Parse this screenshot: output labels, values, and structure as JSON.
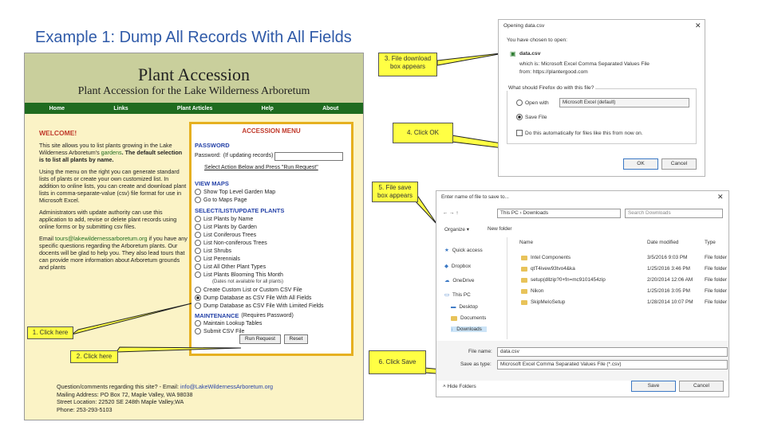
{
  "slide": {
    "title": "Example 1: Dump All Records With All Fields"
  },
  "webpage": {
    "banner_title": "Plant Accession",
    "banner_subtitle": "Plant Accession for the Lake Wilderness Arboretum",
    "nav": [
      "Home",
      "Links",
      "Plant Articles",
      "Help",
      "About"
    ],
    "welcome_heading": "WELCOME!",
    "welcome_p1a": "This site allows you to list plants growing in the Lake Wilderness Arboretum's ",
    "welcome_p1_link": "gardens",
    "welcome_p1b": ". The default selection is to list all plants by name.",
    "welcome_p2": "Using the menu on the right you can generate standard lists of plants or create your own customized list. In addition to online lists, you can create and download plant lists in comma-separate-value (csv) file format for use in Microsoft Excel.",
    "welcome_p3": "Administrators with update authority can use this application to add, revise or delete plant records using online forms or by submitting csv files.",
    "welcome_p4a": "Email ",
    "welcome_p4_link": "tours@lakewildernessarboretum.org",
    "welcome_p4b": " if you have any specific questions regarding the Arboretum plants. Our docents will be glad to help you. They also lead tours that can provide more information about Arboretum grounds and plants",
    "menu": {
      "title": "ACCESSION MENU",
      "password_heading": "PASSWORD",
      "password_note": "(If updating records)",
      "password_label": "Password:",
      "select_action_link": "Select Action Below and Press \"Run Request\"",
      "view_maps_heading": "VIEW MAPS",
      "maps_options": [
        "Show Top Level Garden Map",
        "Go to Maps Page"
      ],
      "select_heading": "SELECT/LIST/UPDATE PLANTS",
      "list_options": [
        "List Plants by Name",
        "List Plants by Garden",
        "List Coniferous Trees",
        "List Non-coniferous Trees",
        "List Shrubs",
        "List Perennials",
        "List All Other Plant Types",
        "List Plants Blooming This Month"
      ],
      "notes_all_plants": "(Dates not available for all plants)",
      "csv_options": [
        "Create Custom List or Custom CSV File",
        "Dump Database as CSV File With All Fields",
        "Dump Database as CSV File With Limited Fields"
      ],
      "maintenance_heading": "MAINTENANCE",
      "maintenance_note": "(Requires Password)",
      "maintenance_options": [
        "Maintain Lookup Tables",
        "Submit CSV File"
      ],
      "run_button": "Run Request",
      "reset_button": "Reset"
    },
    "footer": {
      "question": "Question/comments regarding this site? - Email: ",
      "email": "info@LakeWildernessArboretum.org",
      "mailing": "Mailing Address: PO Box 72, Maple Valley, WA 98038",
      "street": "Street Location: 22520 SE 248th Maple Valley,WA",
      "phone": "Phone: 253-293-5103"
    }
  },
  "callouts": {
    "c1": "1. Click here",
    "c2": "2. Click here",
    "c3": "3. File download box appears",
    "c4": "4. Click OK",
    "c5": "5. File save box appears",
    "c6": "6. Click Save"
  },
  "open_dialog": {
    "title": "Opening data.csv",
    "chosen": "You have chosen to open:",
    "filename": "data.csv",
    "which_is": "which is: Microsoft Excel Comma Separated Values File",
    "from": "from: https://plantergood.com",
    "question": "What should Firefox do with this file?",
    "open_with_label": "Open with",
    "open_with_value": "Microsoft Excel (default)",
    "save_file_label": "Save File",
    "auto_label": "Do this automatically for files like this from now on.",
    "ok": "OK",
    "cancel": "Cancel"
  },
  "save_dialog": {
    "title": "Enter name of file to save to...",
    "path": "This PC  ›  Downloads",
    "search_placeholder": "Search Downloads",
    "organize": "Organize ▾",
    "new_folder": "New folder",
    "col_name": "Name",
    "col_date": "Date modified",
    "col_type": "Type",
    "nav_items": [
      "Quick access",
      "Dropbox",
      "OneDrive",
      "This PC",
      "Desktop",
      "Documents",
      "Downloads"
    ],
    "files": [
      {
        "name": "Intel Components",
        "date": "3/5/2016 9:03 PM",
        "type": "File folder"
      },
      {
        "name": "qtT4ivew93tvo4&ka",
        "date": "1/25/2016 3:46 PM",
        "type": "File folder"
      },
      {
        "name": "setup(dllzip?0+fn=mc9101454zip",
        "date": "2/20/2014 12:06 AM",
        "type": "File folder"
      },
      {
        "name": "Nikon",
        "date": "1/25/2016 3:05 PM",
        "type": "File folder"
      },
      {
        "name": "SkipMeIoSetup",
        "date": "1/28/2014 10:07 PM",
        "type": "File folder"
      }
    ],
    "file_name_label": "File name:",
    "file_name_value": "data.csv",
    "save_type_label": "Save as type:",
    "save_type_value": "Microsoft Excel Comma Separated Values File (*.csv)",
    "hide_folders": "Hide Folders",
    "save": "Save",
    "cancel": "Cancel"
  }
}
